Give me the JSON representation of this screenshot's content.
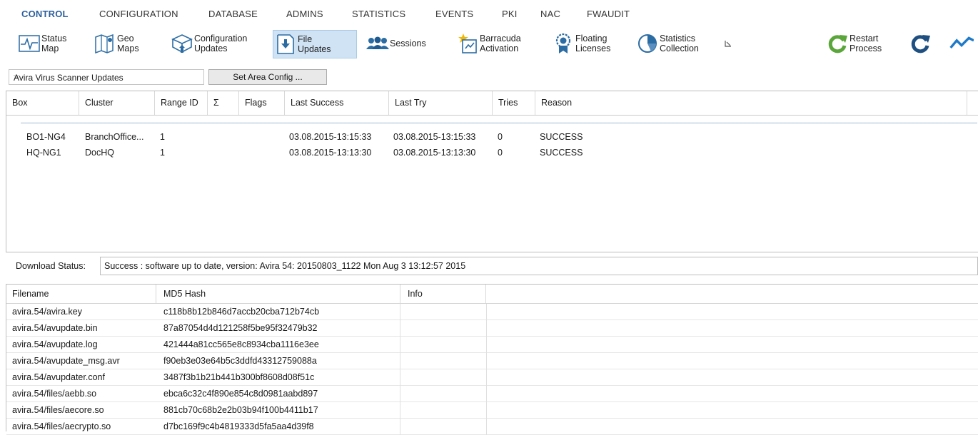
{
  "menu": [
    {
      "label": "CONTROL",
      "active": true
    },
    {
      "label": "CONFIGURATION",
      "active": false
    },
    {
      "label": "DATABASE",
      "active": false
    },
    {
      "label": "ADMINS",
      "active": false
    },
    {
      "label": "STATISTICS",
      "active": false
    },
    {
      "label": "EVENTS",
      "active": false
    },
    {
      "label": "PKI",
      "active": false
    },
    {
      "label": "NAC",
      "active": false
    },
    {
      "label": "FWAUDIT",
      "active": false
    }
  ],
  "ribbon": {
    "status_map": "Status\nMap",
    "geo_maps": "Geo\nMaps",
    "configuration_updates": "Configuration\nUpdates",
    "file_updates": "File\nUpdates",
    "sessions": "Sessions",
    "barracuda_activation": "Barracuda\nActivation",
    "floating_licenses": "Floating\nLicenses",
    "statistics_collection": "Statistics\nCollection",
    "restart_process": "Restart\nProcess"
  },
  "area": {
    "selected": "Avira Virus Scanner Updates",
    "set_button": "Set Area Config ..."
  },
  "upper_table": {
    "headers": {
      "box": "Box",
      "cluster": "Cluster",
      "range_id": "Range ID",
      "sigma": "Σ",
      "flags": "Flags",
      "last_success": "Last Success",
      "last_try": "Last Try",
      "tries": "Tries",
      "reason": "Reason"
    },
    "rows": [
      {
        "box": "BO1-NG4",
        "cluster": "BranchOffice...",
        "range_id": "1",
        "last_success": "03.08.2015-13:15:33",
        "last_try": "03.08.2015-13:15:33",
        "tries": "0",
        "reason": "SUCCESS"
      },
      {
        "box": "HQ-NG1",
        "cluster": "DocHQ",
        "range_id": "1",
        "last_success": "03.08.2015-13:13:30",
        "last_try": "03.08.2015-13:13:30",
        "tries": "0",
        "reason": "SUCCESS"
      }
    ]
  },
  "download_status": {
    "label": "Download Status:",
    "value": "Success : software up to date, version:  Avira 54: 20150803_1122 Mon Aug  3 13:12:57 2015"
  },
  "lower_table": {
    "headers": {
      "filename": "Filename",
      "md5": "MD5 Hash",
      "info": "Info"
    },
    "rows": [
      {
        "filename": "avira.54/avira.key",
        "md5": "c118b8b12b846d7accb20cba712b74cb",
        "info": ""
      },
      {
        "filename": "avira.54/avupdate.bin",
        "md5": "87a87054d4d121258f5be95f32479b32",
        "info": ""
      },
      {
        "filename": "avira.54/avupdate.log",
        "md5": "421444a81cc565e8c8934cba1116e3ee",
        "info": ""
      },
      {
        "filename": "avira.54/avupdate_msg.avr",
        "md5": "f90eb3e03e64b5c3ddfd43312759088a",
        "info": ""
      },
      {
        "filename": "avira.54/avupdater.conf",
        "md5": "3487f3b1b21b441b300bf8608d08f51c",
        "info": ""
      },
      {
        "filename": "avira.54/files/aebb.so",
        "md5": "ebca6c32c4f890e854c8d0981aabd897",
        "info": ""
      },
      {
        "filename": "avira.54/files/aecore.so",
        "md5": "881cb70c68b2e2b03b94f100b4411b17",
        "info": ""
      },
      {
        "filename": "avira.54/files/aecrypto.so",
        "md5": "d7bc169f9c4b4819333d5fa5aa4d39f8",
        "info": ""
      }
    ]
  }
}
